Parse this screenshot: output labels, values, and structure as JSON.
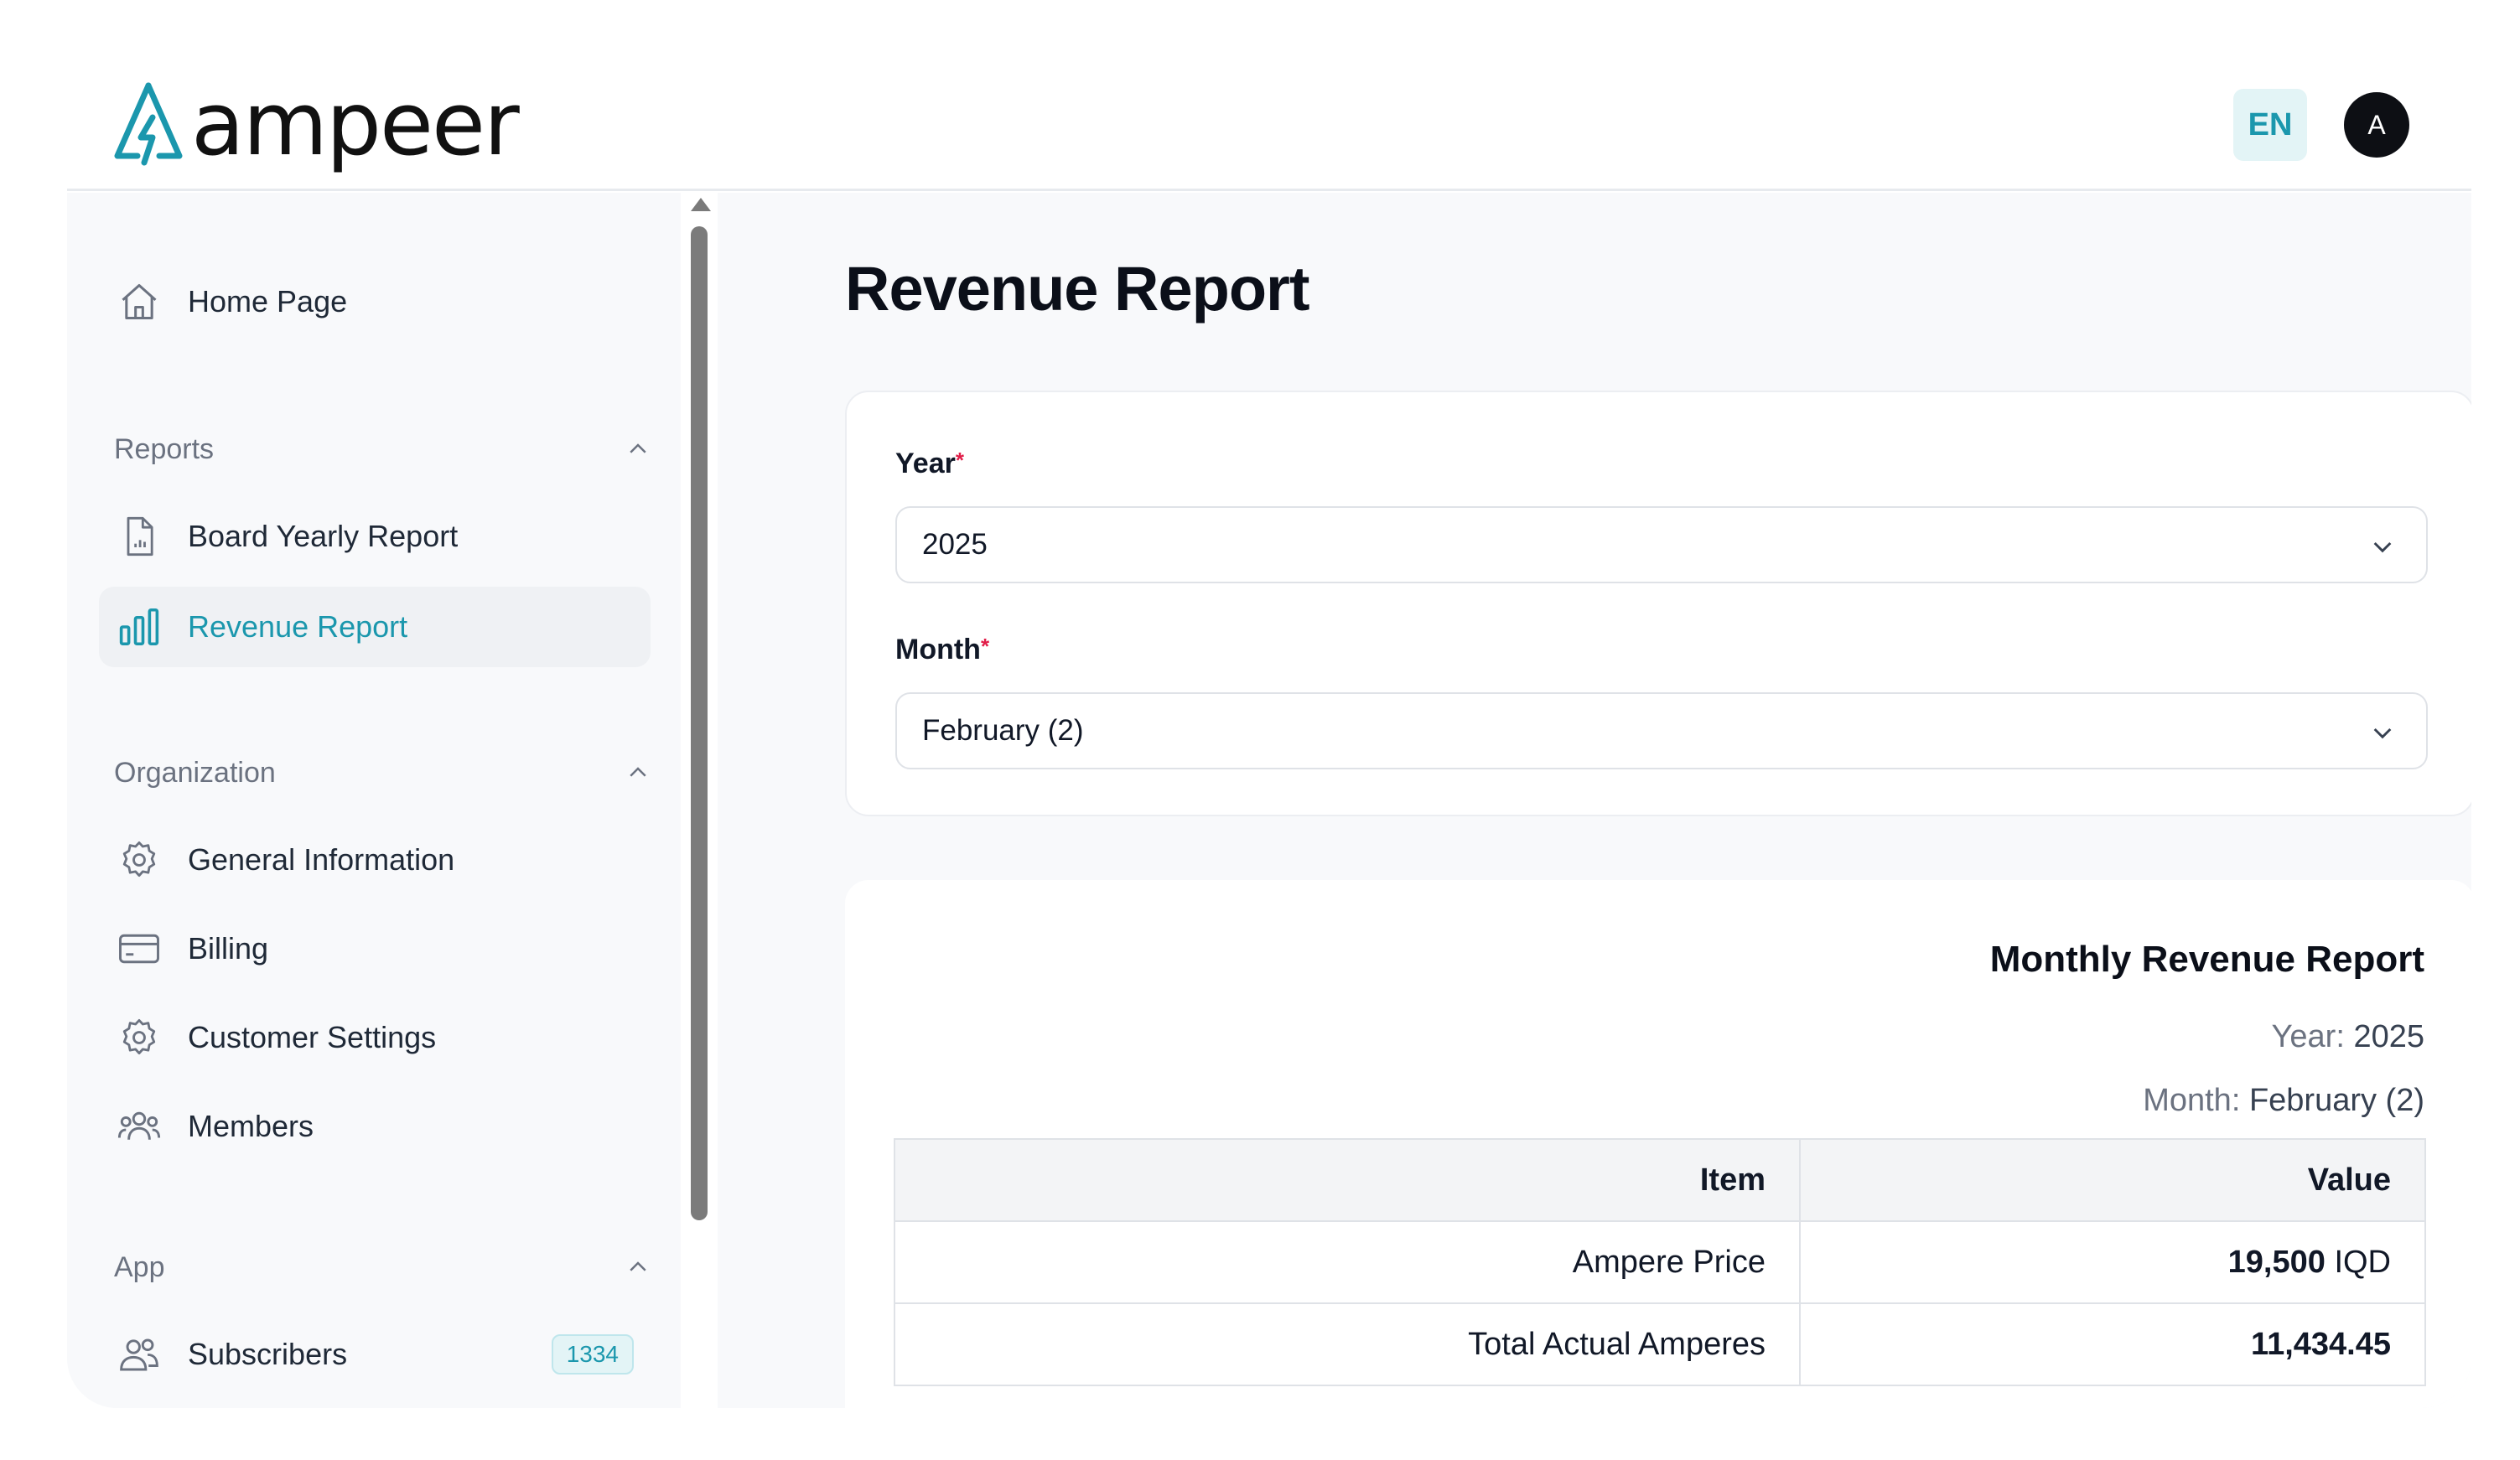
{
  "header": {
    "brand": "ampeer",
    "language": "EN",
    "avatar_initial": "A"
  },
  "sidebar": {
    "home": "Home Page",
    "sections": [
      {
        "label": "Reports",
        "items": [
          {
            "label": "Board Yearly Report"
          },
          {
            "label": "Revenue Report",
            "active": true
          }
        ]
      },
      {
        "label": "Organization",
        "items": [
          {
            "label": "General Information"
          },
          {
            "label": "Billing"
          },
          {
            "label": "Customer Settings"
          },
          {
            "label": "Members"
          }
        ]
      },
      {
        "label": "App",
        "items": [
          {
            "label": "Subscribers",
            "badge": "1334"
          }
        ]
      }
    ]
  },
  "main": {
    "title": "Revenue Report",
    "filters": {
      "year_label": "Year",
      "year_value": "2025",
      "month_label": "Month",
      "month_value": "February (2)",
      "required_mark": "*"
    },
    "report": {
      "title": "Monthly Revenue Report",
      "year_prefix": "Year:",
      "year": "2025",
      "month_prefix": "Month:",
      "month": "February (2)",
      "columns": [
        "Item",
        "Value"
      ],
      "rows": [
        {
          "item": "Ampere Price",
          "value": "19,500",
          "unit": "IQD"
        },
        {
          "item": "Total Actual Amperes",
          "value": "11,434.45",
          "unit": ""
        }
      ]
    }
  },
  "colors": {
    "accent": "#1b97ad",
    "accent_bg": "#e3f4f6",
    "required": "#e11d48"
  }
}
